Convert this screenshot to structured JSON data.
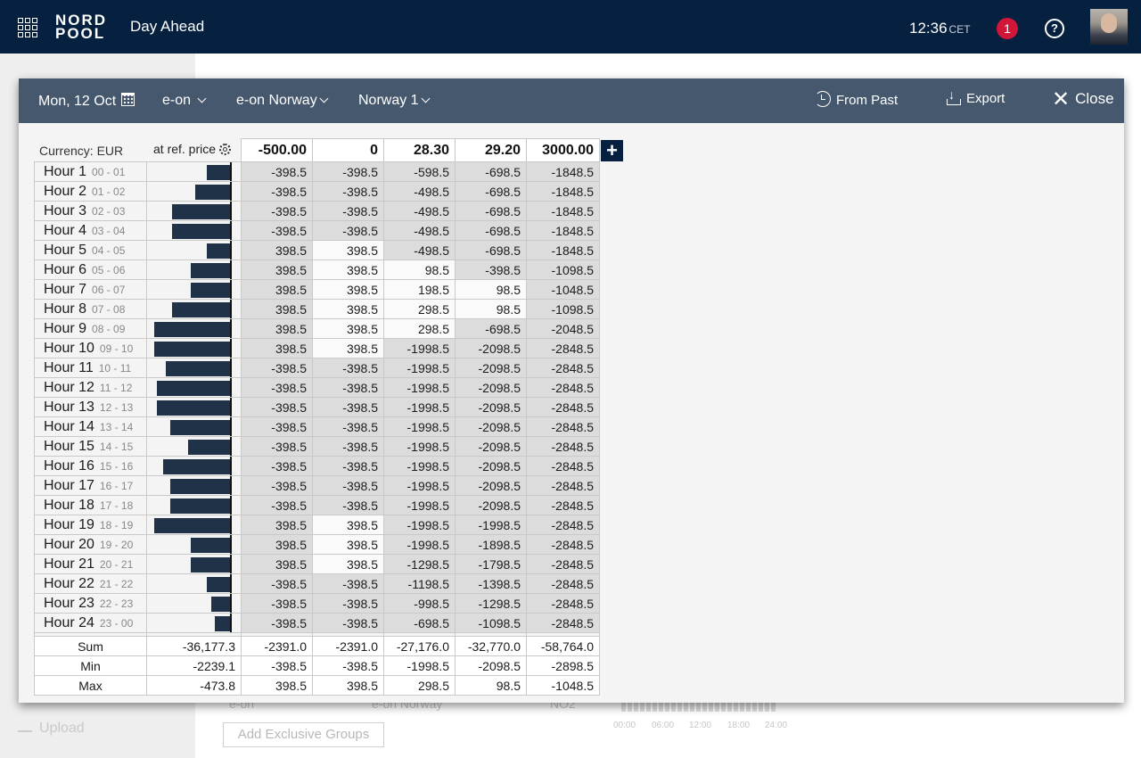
{
  "topbar": {
    "logo_line1": "NORD",
    "logo_line2": "POOL",
    "app_title": "Day Ahead",
    "time": "12:36",
    "timezone": "CET",
    "notification_count": "1",
    "help_label": "?"
  },
  "background": {
    "upload_label": "Upload",
    "row_col1": "e-on",
    "row_col2": "e-on Norway",
    "row_col3": "NO2",
    "add_groups_label": "Add Exclusive Groups",
    "axis_ticks": [
      "00:00",
      "06:00",
      "12:00",
      "18:00",
      "24:00"
    ]
  },
  "modal": {
    "date": "Mon, 12 Oct",
    "company": "e-on",
    "portfolio": "e-on Norway",
    "area": "Norway 1",
    "from_past_label": "From Past",
    "export_label": "Export",
    "close_label": "Close"
  },
  "table": {
    "currency_label": "Currency: EUR",
    "ref_price_label": "at ref. price",
    "add_column_label": "+",
    "price_steps": [
      "-500.00",
      "0",
      "28.30",
      "29.20",
      "3000.00"
    ],
    "rows": [
      {
        "hour": "Hour 1",
        "range": "00 - 01",
        "bar_frac": 0.29,
        "values": [
          "-398.5",
          "-398.5",
          "-598.5",
          "-698.5",
          "-1848.5"
        ],
        "shaded": [
          1,
          1,
          1,
          1,
          1
        ]
      },
      {
        "hour": "Hour 2",
        "range": "01 - 02",
        "bar_frac": 0.44,
        "values": [
          "-398.5",
          "-398.5",
          "-498.5",
          "-698.5",
          "-1848.5"
        ],
        "shaded": [
          1,
          1,
          1,
          1,
          1
        ]
      },
      {
        "hour": "Hour 3",
        "range": "02 - 03",
        "bar_frac": 0.72,
        "values": [
          "-398.5",
          "-398.5",
          "-498.5",
          "-698.5",
          "-1848.5"
        ],
        "shaded": [
          1,
          1,
          1,
          1,
          1
        ]
      },
      {
        "hour": "Hour 4",
        "range": "03 - 04",
        "bar_frac": 0.72,
        "values": [
          "-398.5",
          "-398.5",
          "-498.5",
          "-698.5",
          "-1848.5"
        ],
        "shaded": [
          1,
          1,
          1,
          1,
          1
        ]
      },
      {
        "hour": "Hour 5",
        "range": "04 - 05",
        "bar_frac": 0.29,
        "values": [
          "398.5",
          "398.5",
          "-498.5",
          "-698.5",
          "-1848.5"
        ],
        "shaded": [
          1,
          0,
          1,
          1,
          1
        ]
      },
      {
        "hour": "Hour 6",
        "range": "05 - 06",
        "bar_frac": 0.49,
        "values": [
          "398.5",
          "398.5",
          "98.5",
          "-398.5",
          "-1098.5"
        ],
        "shaded": [
          1,
          0,
          0,
          1,
          1
        ]
      },
      {
        "hour": "Hour 7",
        "range": "06 - 07",
        "bar_frac": 0.49,
        "values": [
          "398.5",
          "398.5",
          "198.5",
          "98.5",
          "-1048.5"
        ],
        "shaded": [
          1,
          0,
          0,
          0,
          1
        ]
      },
      {
        "hour": "Hour 8",
        "range": "07 - 08",
        "bar_frac": 0.72,
        "values": [
          "398.5",
          "398.5",
          "298.5",
          "98.5",
          "-1098.5"
        ],
        "shaded": [
          1,
          0,
          0,
          0,
          1
        ]
      },
      {
        "hour": "Hour 9",
        "range": "08 - 09",
        "bar_frac": 0.93,
        "values": [
          "398.5",
          "398.5",
          "298.5",
          "-698.5",
          "-2048.5"
        ],
        "shaded": [
          1,
          0,
          0,
          1,
          1
        ]
      },
      {
        "hour": "Hour 10",
        "range": "09 - 10",
        "bar_frac": 0.93,
        "values": [
          "398.5",
          "398.5",
          "-1998.5",
          "-2098.5",
          "-2848.5"
        ],
        "shaded": [
          1,
          0,
          1,
          1,
          1
        ]
      },
      {
        "hour": "Hour 11",
        "range": "10 - 11",
        "bar_frac": 0.79,
        "values": [
          "-398.5",
          "-398.5",
          "-1998.5",
          "-2098.5",
          "-2848.5"
        ],
        "shaded": [
          1,
          1,
          1,
          1,
          1
        ]
      },
      {
        "hour": "Hour 12",
        "range": "11 - 12",
        "bar_frac": 0.9,
        "values": [
          "-398.5",
          "-398.5",
          "-1998.5",
          "-2098.5",
          "-2848.5"
        ],
        "shaded": [
          1,
          1,
          1,
          1,
          1
        ]
      },
      {
        "hour": "Hour 13",
        "range": "12 - 13",
        "bar_frac": 0.9,
        "values": [
          "-398.5",
          "-398.5",
          "-1998.5",
          "-2098.5",
          "-2848.5"
        ],
        "shaded": [
          1,
          1,
          1,
          1,
          1
        ]
      },
      {
        "hour": "Hour 14",
        "range": "13 - 14",
        "bar_frac": 0.74,
        "values": [
          "-398.5",
          "-398.5",
          "-1998.5",
          "-2098.5",
          "-2848.5"
        ],
        "shaded": [
          1,
          1,
          1,
          1,
          1
        ]
      },
      {
        "hour": "Hour 15",
        "range": "14 - 15",
        "bar_frac": 0.52,
        "values": [
          "-398.5",
          "-398.5",
          "-1998.5",
          "-2098.5",
          "-2848.5"
        ],
        "shaded": [
          1,
          1,
          1,
          1,
          1
        ]
      },
      {
        "hour": "Hour 16",
        "range": "15 - 16",
        "bar_frac": 0.83,
        "values": [
          "-398.5",
          "-398.5",
          "-1998.5",
          "-2098.5",
          "-2848.5"
        ],
        "shaded": [
          1,
          1,
          1,
          1,
          1
        ]
      },
      {
        "hour": "Hour 17",
        "range": "16 - 17",
        "bar_frac": 0.74,
        "values": [
          "-398.5",
          "-398.5",
          "-1998.5",
          "-2098.5",
          "-2848.5"
        ],
        "shaded": [
          1,
          1,
          1,
          1,
          1
        ]
      },
      {
        "hour": "Hour 18",
        "range": "17 - 18",
        "bar_frac": 0.74,
        "values": [
          "-398.5",
          "-398.5",
          "-1998.5",
          "-2098.5",
          "-2848.5"
        ],
        "shaded": [
          1,
          1,
          1,
          1,
          1
        ]
      },
      {
        "hour": "Hour 19",
        "range": "18 - 19",
        "bar_frac": 0.93,
        "values": [
          "398.5",
          "398.5",
          "-1998.5",
          "-1998.5",
          "-2848.5"
        ],
        "shaded": [
          1,
          0,
          1,
          1,
          1
        ]
      },
      {
        "hour": "Hour 20",
        "range": "19 - 20",
        "bar_frac": 0.49,
        "values": [
          "398.5",
          "398.5",
          "-1998.5",
          "-1898.5",
          "-2848.5"
        ],
        "shaded": [
          1,
          0,
          1,
          1,
          1
        ]
      },
      {
        "hour": "Hour 21",
        "range": "20 - 21",
        "bar_frac": 0.49,
        "values": [
          "398.5",
          "398.5",
          "-1298.5",
          "-1798.5",
          "-2848.5"
        ],
        "shaded": [
          1,
          0,
          1,
          1,
          1
        ]
      },
      {
        "hour": "Hour 22",
        "range": "21 - 22",
        "bar_frac": 0.29,
        "values": [
          "-398.5",
          "-398.5",
          "-1198.5",
          "-1398.5",
          "-2848.5"
        ],
        "shaded": [
          1,
          1,
          1,
          1,
          1
        ]
      },
      {
        "hour": "Hour 23",
        "range": "22 - 23",
        "bar_frac": 0.24,
        "values": [
          "-398.5",
          "-398.5",
          "-998.5",
          "-1298.5",
          "-2848.5"
        ],
        "shaded": [
          1,
          1,
          1,
          1,
          1
        ]
      },
      {
        "hour": "Hour 24",
        "range": "23 - 00",
        "bar_frac": 0.2,
        "values": [
          "-398.5",
          "-398.5",
          "-698.5",
          "-1098.5",
          "-2848.5"
        ],
        "shaded": [
          1,
          1,
          1,
          1,
          1
        ]
      }
    ],
    "summary": [
      {
        "label": "Sum",
        "ref": "-36,177.3",
        "values": [
          "-2391.0",
          "-2391.0",
          "-27,176.0",
          "-32,770.0",
          "-58,764.0"
        ]
      },
      {
        "label": "Min",
        "ref": "-2239.1",
        "values": [
          "-398.5",
          "-398.5",
          "-1998.5",
          "-2098.5",
          "-2898.5"
        ]
      },
      {
        "label": "Max",
        "ref": "-473.8",
        "values": [
          "398.5",
          "398.5",
          "298.5",
          "98.5",
          "-1048.5"
        ]
      }
    ]
  },
  "colors": {
    "topbar": "#06203f",
    "modal_header": "#46586e",
    "bar": "#1f3247",
    "notification": "#d0173a",
    "shaded_cell": "#dcdcdc"
  }
}
